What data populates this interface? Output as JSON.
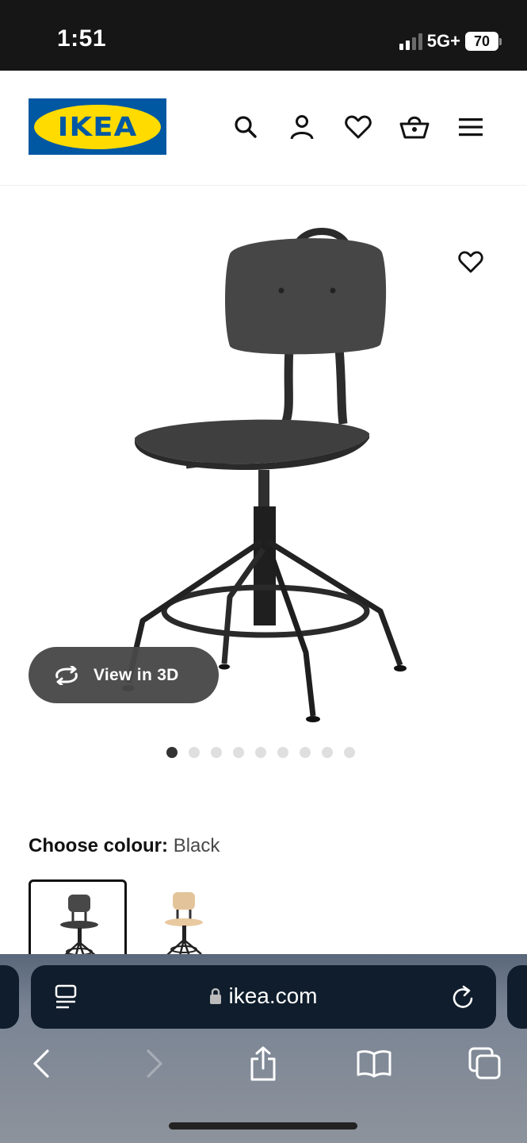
{
  "status_bar": {
    "time": "1:51",
    "network": "5G+",
    "battery": "70"
  },
  "header": {
    "logo_text": "IKEA",
    "icons": [
      "search-icon",
      "account-icon",
      "heart-icon",
      "basket-icon",
      "menu-icon"
    ]
  },
  "product": {
    "view_3d_label": "View in 3D",
    "gallery_total": 9,
    "gallery_active": 1
  },
  "colour": {
    "label": "Choose colour:",
    "value": "Black",
    "options": [
      "Black",
      "Birch"
    ]
  },
  "browser": {
    "url": "ikea.com"
  },
  "colors": {
    "ikea_blue": "#0058a3",
    "ikea_yellow": "#ffdb00"
  }
}
